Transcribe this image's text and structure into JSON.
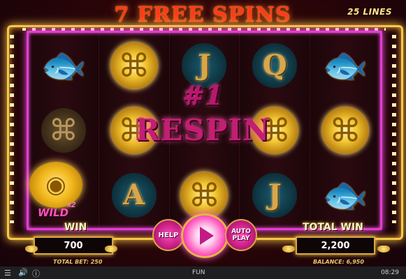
{
  "header": {
    "free_spins_title": "7 FREE SPINS",
    "lines_label": "25 LINES"
  },
  "reels": [
    [
      "fish-icon",
      "knot-dark-icon",
      "wild-coin"
    ],
    [
      "knot-gold-icon",
      "knot-gold-icon",
      "A"
    ],
    [
      "J",
      "",
      "knot-gold-icon"
    ],
    [
      "Q",
      "knot-gold-icon",
      "J"
    ],
    [
      "fish-icon",
      "knot-gold-icon",
      "fish-icon"
    ]
  ],
  "respin": {
    "number": "#1",
    "word": "RESPIN"
  },
  "wild": {
    "label": "WILD",
    "multiplier": "x2"
  },
  "panels": {
    "win_label": "WIN",
    "win_value": "700",
    "total_win_label": "TOTAL WIN",
    "total_win_value": "2,200"
  },
  "buttons": {
    "help_label": "HELP",
    "auto_label_1": "AUTO",
    "auto_label_2": "PLAY"
  },
  "status": {
    "total_bet": "TOTAL BET: 250",
    "balance": "BALANCE: 6,950"
  },
  "system_bar": {
    "mode": "FUN",
    "clock": "08:29"
  },
  "colors": {
    "accent_gold": "#f5c94a",
    "accent_magenta": "#e43cd6",
    "title_red": "#ff3a1a",
    "respin_pink": "#c41e73"
  }
}
